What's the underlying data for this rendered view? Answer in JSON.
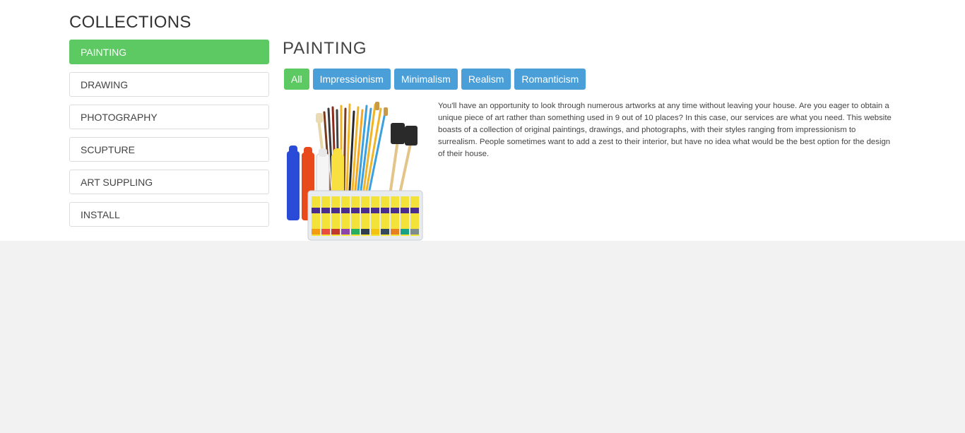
{
  "sidebar": {
    "title": "COLLECTIONS",
    "items": [
      {
        "label": "PAINTING",
        "active": true
      },
      {
        "label": "DRAWING",
        "active": false
      },
      {
        "label": "PHOTOGRAPHY",
        "active": false
      },
      {
        "label": "SCUPTURE",
        "active": false
      },
      {
        "label": "ART SUPPLING",
        "active": false
      },
      {
        "label": "INSTALL",
        "active": false
      }
    ]
  },
  "main": {
    "title": "PAINTING",
    "filters": [
      {
        "label": "All",
        "active": true
      },
      {
        "label": "Impressionism",
        "active": false
      },
      {
        "label": "Minimalism",
        "active": false
      },
      {
        "label": "Realism",
        "active": false
      },
      {
        "label": "Romanticism",
        "active": false
      }
    ],
    "image_icon": "art-supplies-image",
    "description": "You'll have an opportunity to look through numerous artworks at any time without leaving your house. Are you eager to obtain a unique piece of art rather than something used in 9 out of 10 places? In this case, our services are what you need. This website boasts of a collection of original paintings, drawings, and photographs, with their styles ranging from impressionism to surrealism. People sometimes want to add a zest to their interior, but have no idea what would be the best option for the design of their house."
  },
  "colors": {
    "accent_green": "#5cc962",
    "filter_blue": "#4a9fd8",
    "page_background": "#f2f2f2"
  }
}
